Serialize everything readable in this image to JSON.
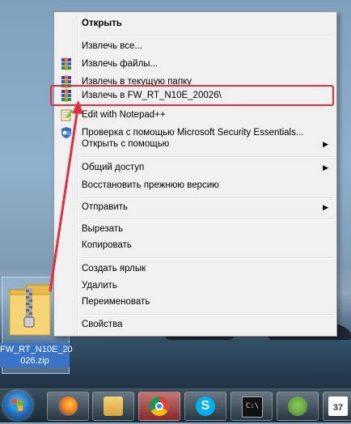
{
  "context_menu": {
    "items": [
      {
        "label": "Открыть",
        "bold": true,
        "icon": "",
        "submenu": false
      },
      {
        "label": "Извлечь все...",
        "icon": "",
        "submenu": false
      },
      {
        "label": "Извлечь файлы...",
        "icon": "winrar-icon",
        "submenu": false
      },
      {
        "label": "Извлечь в текущую папку",
        "icon": "winrar-icon",
        "submenu": false
      },
      {
        "label": "Извлечь в FW_RT_N10E_20026\\",
        "icon": "winrar-icon",
        "submenu": false,
        "highlighted": true
      },
      {
        "label": "Edit with Notepad++",
        "icon": "notepad-plus-plus-icon",
        "submenu": false
      },
      {
        "label": "Проверка с помощью Microsoft Security Essentials...",
        "icon": "security-essentials-icon",
        "submenu": false
      },
      {
        "label": "Открыть с помощью",
        "icon": "",
        "submenu": true
      },
      {
        "label": "Общий доступ",
        "icon": "",
        "submenu": true
      },
      {
        "label": "Восстановить прежнюю версию",
        "icon": "",
        "submenu": false
      },
      {
        "label": "Отправить",
        "icon": "",
        "submenu": true
      },
      {
        "label": "Вырезать",
        "icon": "",
        "submenu": false
      },
      {
        "label": "Копировать",
        "icon": "",
        "submenu": false
      },
      {
        "label": "Создать ярлык",
        "icon": "",
        "submenu": false
      },
      {
        "label": "Удалить",
        "icon": "",
        "submenu": false
      },
      {
        "label": "Переименовать",
        "icon": "",
        "submenu": false
      },
      {
        "label": "Свойства",
        "icon": "",
        "submenu": false
      }
    ],
    "highlight_color": "#e0303c"
  },
  "desktop": {
    "file_name_line1": "FW_RT_N10E_20",
    "file_name_line2": "026.zip",
    "file_icon": "zip-folder-icon"
  },
  "taskbar": {
    "start_icon": "windows-start-icon",
    "apps": [
      {
        "name": "firefox",
        "icon": "firefox-icon"
      },
      {
        "name": "explorer",
        "icon": "folder-icon"
      },
      {
        "name": "chrome",
        "icon": "chrome-icon",
        "active": true
      },
      {
        "name": "skype",
        "icon": "skype-icon"
      },
      {
        "name": "cmd",
        "icon": "command-prompt-icon"
      },
      {
        "name": "evernote",
        "icon": "evernote-icon"
      },
      {
        "name": "calendar",
        "icon": "calendar-icon",
        "badge": "37"
      }
    ]
  }
}
